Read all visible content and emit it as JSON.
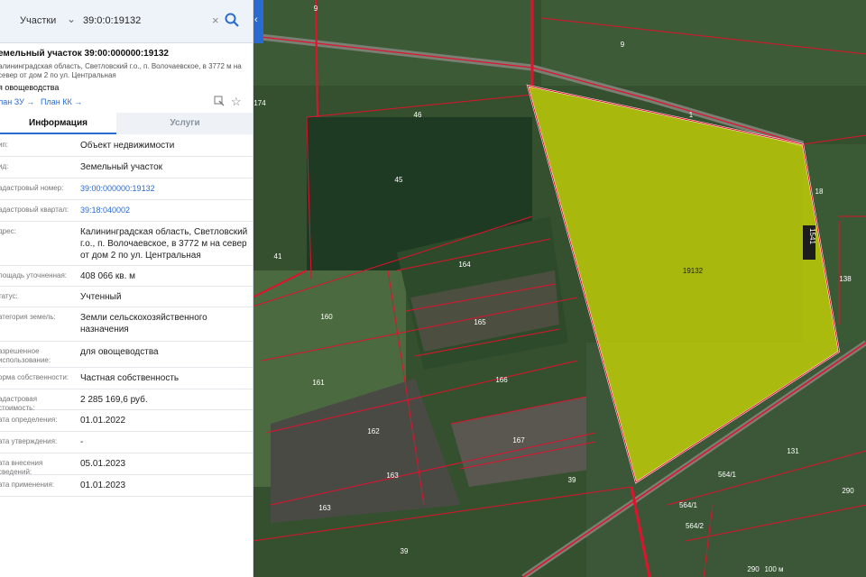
{
  "search": {
    "type_label": "Участки",
    "query": "39:0:0:19132"
  },
  "parcel": {
    "title": "емельный участок 39:00:000000:19132",
    "address_short": "алининградская область, Светловский г.о., п. Волочаевское, в 3772 м на север от дом 2 по ул. Центральная",
    "usage": "я овощеводства",
    "plan_zu": "лан ЗУ →",
    "plan_kk": "План КК →"
  },
  "tabs": [
    "Информация",
    "Услуги"
  ],
  "info_rows": [
    {
      "key": "ип:",
      "value": "Объект недвижимости",
      "link": false
    },
    {
      "key": "ид:",
      "value": "Земельный участок",
      "link": false
    },
    {
      "key": "адастровый номер:",
      "value": "39:00:000000:19132",
      "link": true
    },
    {
      "key": "адастровый квартал:",
      "value": "39:18:040002",
      "link": true
    },
    {
      "key": "дрес:",
      "value": "Калининградская область, Светловский г.о., п. Волочаевское, в 3772 м на север от дом 2 по ул. Центральная",
      "link": false
    },
    {
      "key": "лощадь уточненная:",
      "value": "408 066 кв. м",
      "link": false
    },
    {
      "key": "татус:",
      "value": "Учтенный",
      "link": false
    },
    {
      "key": "атегория земель:",
      "value": "Земли сельскохозяйственного назначения",
      "link": false
    },
    {
      "key": "азрешенное использование:",
      "value": "для овощеводства",
      "link": false
    },
    {
      "key": "орма собственности:",
      "value": "Частная собственность",
      "link": false
    },
    {
      "key": "адастровая стоимость:",
      "value": "2 285 169,6 руб.",
      "link": false
    },
    {
      "key": "ата определения:",
      "value": "01.01.2022",
      "link": false
    },
    {
      "key": "ата утверждения:",
      "value": "-",
      "link": false
    },
    {
      "key": "ата внесения сведений:",
      "value": "05.01.2023",
      "link": false
    },
    {
      "key": "ата применения:",
      "value": "01.01.2023",
      "link": false
    }
  ],
  "map_labels": [
    "9",
    "9",
    "1",
    "46",
    "174",
    "45",
    "18",
    "41",
    "164",
    "19132",
    "138",
    "160",
    "165",
    "161",
    "166",
    "162",
    "167",
    "131",
    "163",
    "39",
    "564/1",
    "564/1",
    "564/2",
    "163",
    "39",
    "290",
    "290",
    "100 м",
    "1541"
  ],
  "colors": {
    "accent": "#2a6bd1",
    "selected_parcel_fill": "#d7e000",
    "parcel_border": "#e0122d"
  }
}
